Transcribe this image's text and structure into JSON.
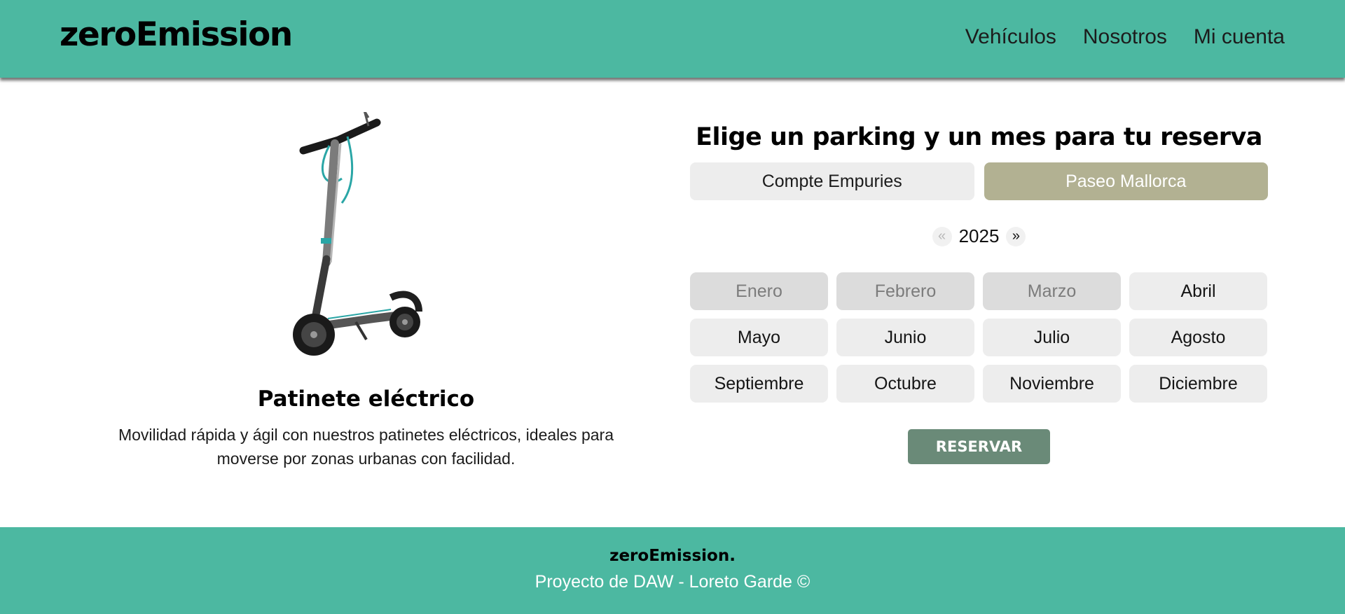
{
  "header": {
    "brand": "zeroEmission",
    "nav": [
      {
        "label": "Vehículos"
      },
      {
        "label": "Nosotros"
      },
      {
        "label": "Mi cuenta"
      }
    ]
  },
  "product": {
    "image_alt": "electric-scooter-image",
    "title": "Patinete eléctrico",
    "description": "Movilidad rápida y ágil con nuestros patinetes eléctricos, ideales para moverse por zonas urbanas con facilidad."
  },
  "booking": {
    "title": "Elige un parking y un mes para tu reserva",
    "parkings": [
      {
        "label": "Compte Empuries",
        "selected": false
      },
      {
        "label": "Paseo Mallorca",
        "selected": true
      }
    ],
    "year": {
      "prev": "«",
      "value": "2025",
      "next": "»"
    },
    "months": [
      {
        "label": "Enero",
        "disabled": true
      },
      {
        "label": "Febrero",
        "disabled": true
      },
      {
        "label": "Marzo",
        "disabled": true
      },
      {
        "label": "Abril",
        "disabled": false
      },
      {
        "label": "Mayo",
        "disabled": false
      },
      {
        "label": "Junio",
        "disabled": false
      },
      {
        "label": "Julio",
        "disabled": false
      },
      {
        "label": "Agosto",
        "disabled": false
      },
      {
        "label": "Septiembre",
        "disabled": false
      },
      {
        "label": "Octubre",
        "disabled": false
      },
      {
        "label": "Noviembre",
        "disabled": false
      },
      {
        "label": "Diciembre",
        "disabled": false
      }
    ],
    "reserve_label": "RESERVAR"
  },
  "footer": {
    "brand": "zeroEmission.",
    "credit": "Proyecto de DAW - Loreto Garde ©"
  },
  "colors": {
    "header_footer_bg": "#4cb8a1",
    "selected_parking": "#b2b192",
    "reserve_button": "#6a8a78",
    "option_bg": "#ededed",
    "disabled_month_bg": "#dcdcdc"
  }
}
